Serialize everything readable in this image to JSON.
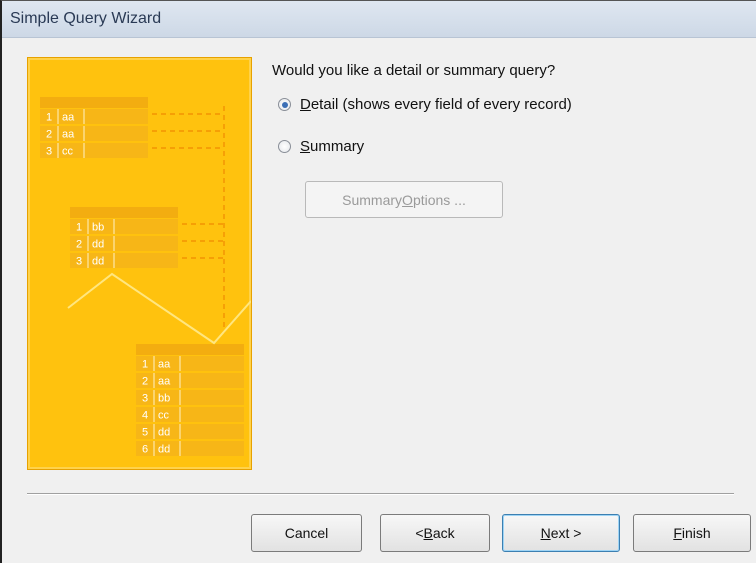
{
  "window": {
    "title": "Simple Query Wizard"
  },
  "illustration": {
    "table1": [
      [
        "1",
        "aa"
      ],
      [
        "2",
        "aa"
      ],
      [
        "3",
        "cc"
      ]
    ],
    "table2": [
      [
        "1",
        "bb"
      ],
      [
        "2",
        "dd"
      ],
      [
        "3",
        "dd"
      ]
    ],
    "result": [
      [
        "1",
        "aa"
      ],
      [
        "2",
        "aa"
      ],
      [
        "3",
        "bb"
      ],
      [
        "4",
        "cc"
      ],
      [
        "5",
        "dd"
      ],
      [
        "6",
        "dd"
      ]
    ]
  },
  "question": "Would you like a detail or summary query?",
  "options": {
    "detail": {
      "mnemonic": "D",
      "rest": "etail (shows every field of every record)",
      "selected": true
    },
    "summary": {
      "mnemonic": "S",
      "rest": "ummary",
      "selected": false
    }
  },
  "summary_options_button": {
    "pre": "Summary ",
    "mnemonic": "O",
    "post": "ptions ...",
    "enabled": false
  },
  "footer": {
    "cancel": "Cancel",
    "back": {
      "pre": "< ",
      "mnemonic": "B",
      "post": "ack"
    },
    "next": {
      "mnemonic": "N",
      "post": "ext >"
    },
    "finish": {
      "mnemonic": "F",
      "post": "inish"
    }
  }
}
